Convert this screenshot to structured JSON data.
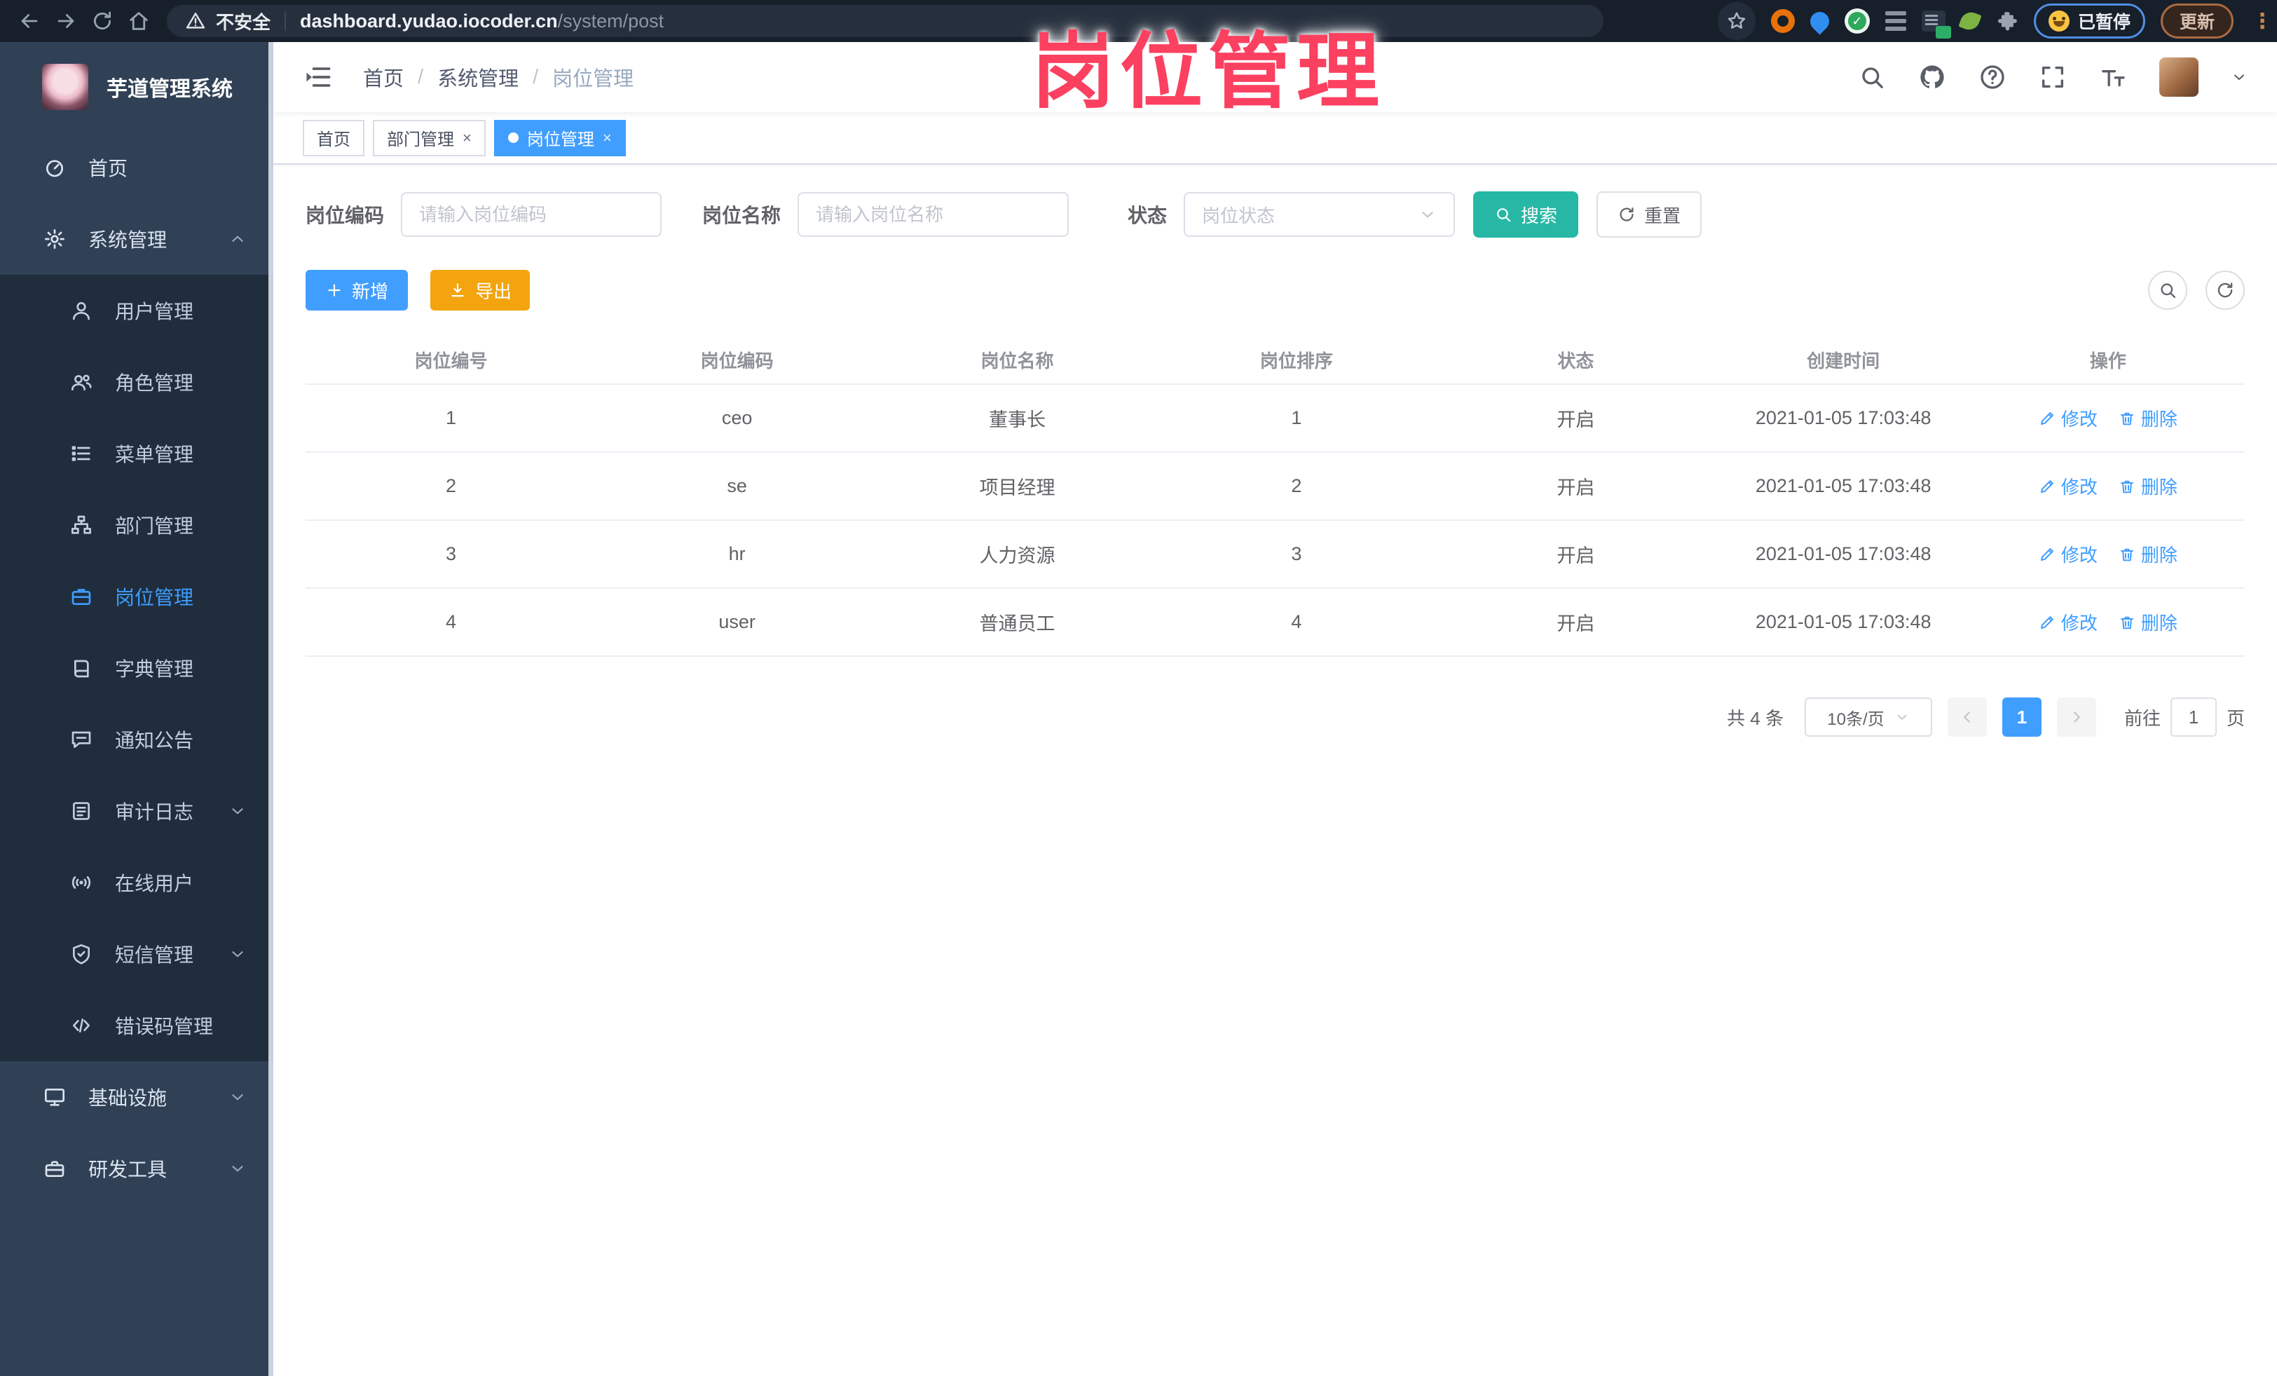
{
  "overlay_title": "岗位管理",
  "browser": {
    "security_label": "不安全",
    "url_host": "dashboard.yudao.iocoder.cn",
    "url_path": "/system/post",
    "paused_badge": "已暂停",
    "update_label": "更新"
  },
  "sidebar": {
    "app_title": "芋道管理系统",
    "top_items": [
      {
        "label": "首页",
        "icon": "dashboard"
      },
      {
        "label": "系统管理",
        "icon": "gear",
        "chevron": "chev-up"
      }
    ],
    "submenu_items": [
      {
        "label": "用户管理",
        "icon": "user"
      },
      {
        "label": "角色管理",
        "icon": "users"
      },
      {
        "label": "菜单管理",
        "icon": "list"
      },
      {
        "label": "部门管理",
        "icon": "org"
      },
      {
        "label": "岗位管理",
        "icon": "badge",
        "active": true
      },
      {
        "label": "字典管理",
        "icon": "book"
      },
      {
        "label": "通知公告",
        "icon": "message"
      },
      {
        "label": "审计日志",
        "icon": "log",
        "chevron": "chev-down"
      },
      {
        "label": "在线用户",
        "icon": "online"
      },
      {
        "label": "短信管理",
        "icon": "shield",
        "chevron": "chev-down"
      },
      {
        "label": "错误码管理",
        "icon": "code"
      }
    ],
    "bottom_items": [
      {
        "label": "基础设施",
        "icon": "monitor",
        "chevron": "chev-down"
      },
      {
        "label": "研发工具",
        "icon": "toolbox",
        "chevron": "chev-down"
      }
    ]
  },
  "header": {
    "breadcrumb": [
      {
        "label": "首页"
      },
      {
        "label": "系统管理"
      },
      {
        "label": "岗位管理",
        "current": true
      }
    ]
  },
  "tabs": [
    {
      "label": "首页"
    },
    {
      "label": "部门管理",
      "closable": true
    },
    {
      "label": "岗位管理",
      "closable": true,
      "active": true
    }
  ],
  "filters": {
    "post_code_label": "岗位编码",
    "post_code_placeholder": "请输入岗位编码",
    "post_name_label": "岗位名称",
    "post_name_placeholder": "请输入岗位名称",
    "status_label": "状态",
    "status_placeholder": "岗位状态",
    "search_label": "搜索",
    "reset_label": "重置"
  },
  "toolbar": {
    "add_label": "新增",
    "export_label": "导出"
  },
  "table": {
    "columns": [
      "岗位编号",
      "岗位编码",
      "岗位名称",
      "岗位排序",
      "状态",
      "创建时间",
      "操作"
    ],
    "edit_label": "修改",
    "delete_label": "删除",
    "rows": [
      {
        "id": "1",
        "code": "ceo",
        "name": "董事长",
        "sort": "1",
        "status": "开启",
        "created": "2021-01-05 17:03:48"
      },
      {
        "id": "2",
        "code": "se",
        "name": "项目经理",
        "sort": "2",
        "status": "开启",
        "created": "2021-01-05 17:03:48"
      },
      {
        "id": "3",
        "code": "hr",
        "name": "人力资源",
        "sort": "3",
        "status": "开启",
        "created": "2021-01-05 17:03:48"
      },
      {
        "id": "4",
        "code": "user",
        "name": "普通员工",
        "sort": "4",
        "status": "开启",
        "created": "2021-01-05 17:03:48"
      }
    ]
  },
  "pagination": {
    "total": "共 4 条",
    "page_size": "10条/页",
    "page": "1",
    "goto_label": "前往",
    "goto_value": "1",
    "unit": "页"
  },
  "colors": {
    "primary": "#409eff",
    "search_teal": "#26b8a5",
    "export_orange": "#f3a40e",
    "sidebar_bg": "#304156",
    "submenu_bg": "#1f2d3d",
    "overlay_pink": "#fb4060"
  }
}
